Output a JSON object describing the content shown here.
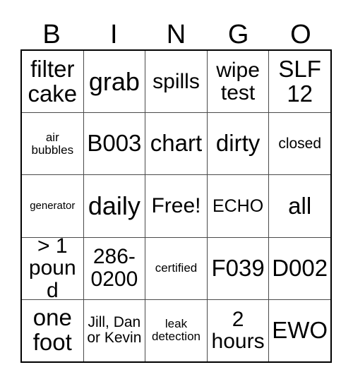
{
  "card": {
    "headers": [
      "B",
      "I",
      "N",
      "G",
      "O"
    ],
    "rows": [
      [
        {
          "text": "filter cake",
          "size": "lg"
        },
        {
          "text": "grab",
          "size": "xl"
        },
        {
          "text": "spills",
          "size": "md"
        },
        {
          "text": "wipe test",
          "size": "md"
        },
        {
          "text": "SLF 12",
          "size": "lg"
        }
      ],
      [
        {
          "text": "air bubbles",
          "size": "xxs"
        },
        {
          "text": "B003",
          "size": "lg"
        },
        {
          "text": "chart",
          "size": "lg"
        },
        {
          "text": "dirty",
          "size": "lg"
        },
        {
          "text": "closed",
          "size": "xs"
        }
      ],
      [
        {
          "text": "generator",
          "size": "tiny"
        },
        {
          "text": "daily",
          "size": "xl"
        },
        {
          "text": "Free!",
          "size": "md"
        },
        {
          "text": "ECHO",
          "size": "sm"
        },
        {
          "text": "all",
          "size": "lg"
        }
      ],
      [
        {
          "text": "> 1 pound",
          "size": "md"
        },
        {
          "text": "286-0200",
          "size": "md"
        },
        {
          "text": "certified",
          "size": "xxs"
        },
        {
          "text": "F039",
          "size": "lg"
        },
        {
          "text": "D002",
          "size": "lg"
        }
      ],
      [
        {
          "text": "one foot",
          "size": "lg"
        },
        {
          "text": "Jill, Dan or Kevin",
          "size": "xs"
        },
        {
          "text": "leak detection",
          "size": "xxs"
        },
        {
          "text": "2 hours",
          "size": "md"
        },
        {
          "text": "EWO",
          "size": "lg"
        }
      ]
    ]
  },
  "colors": {
    "background": "#ffffff",
    "text": "#000000",
    "outer_border": "#000000",
    "inner_gridline": "#4a4a4a"
  }
}
